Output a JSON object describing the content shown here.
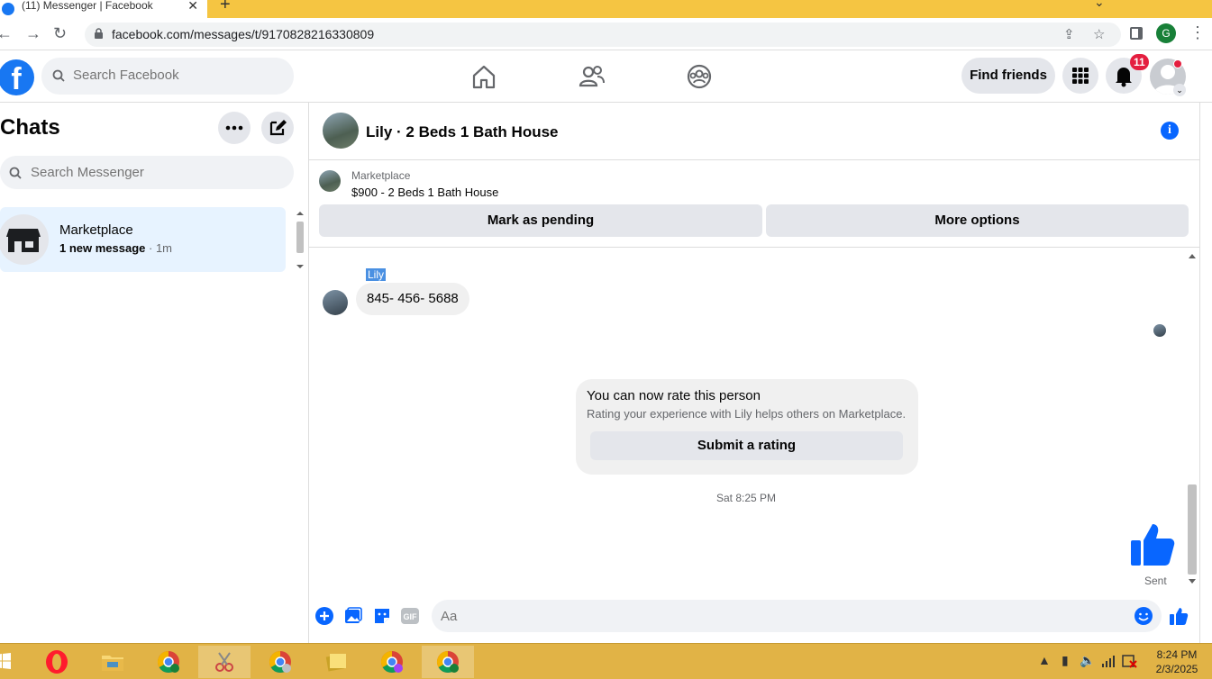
{
  "browser": {
    "tab_title": "(11) Messenger | Facebook",
    "tab_close": "✕",
    "new_tab": "+",
    "url": "facebook.com/messages/t/9170828216330809",
    "profile_letter": "G"
  },
  "fb_header": {
    "logo": "f",
    "search_placeholder": "Search Facebook",
    "find_friends": "Find friends",
    "notifications_count": "11"
  },
  "sidebar": {
    "title": "Chats",
    "search_placeholder": "Search Messenger",
    "chats": [
      {
        "name": "Marketplace",
        "preview": "1 new message",
        "time": "· 1m"
      }
    ]
  },
  "conversation": {
    "title": "Lily · 2 Beds 1 Bath House",
    "marketplace": {
      "label": "Marketplace",
      "item": "$900 - 2 Beds 1 Bath House",
      "mark_pending": "Mark as pending",
      "more_options": "More options"
    },
    "messages": {
      "sender": "Lily",
      "text": "845- 456- 5688"
    },
    "rating_card": {
      "title": "You can now rate this person",
      "subtitle": "Rating your experience with Lily helps others on Marketplace.",
      "button": "Submit a rating"
    },
    "timestamp": "Sat 8:25 PM",
    "sent_label": "Sent",
    "composer_placeholder": "Aa"
  },
  "taskbar": {
    "time": "8:24 PM",
    "date": "2/3/2025"
  },
  "colors": {
    "fb_blue": "#1877f2",
    "messenger_blue": "#0866ff",
    "chrome_frame": "#f5c542",
    "taskbar": "#e1b346"
  }
}
